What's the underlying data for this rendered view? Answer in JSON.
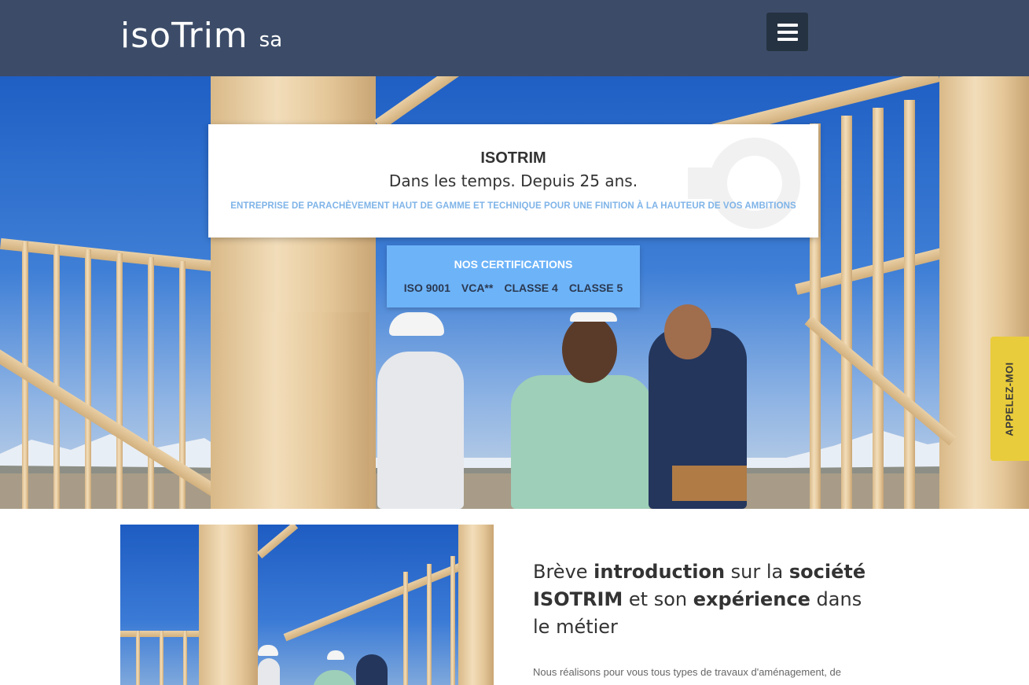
{
  "header": {
    "logo_main": "isoTrim",
    "logo_sub": "sa",
    "menu_icon": "hamburger-icon"
  },
  "hero": {
    "title": "ISOTRIM",
    "subtitle": "Dans les temps. Depuis 25 ans.",
    "description": "ENTREPRISE DE PARACHÈVEMENT HAUT DE GAMME ET TECHNIQUE POUR UNE FINITION À LA HAUTEUR DE VOS AMBITIONS",
    "certifications": {
      "title": "NOS CERTIFICATIONS",
      "items": [
        "ISO 9001",
        "VCA**",
        "CLASSE 4",
        "CLASSE 5"
      ]
    }
  },
  "call_tab": {
    "label": "APPELEZ-MOI"
  },
  "intro": {
    "title_parts": [
      {
        "text": "Brève ",
        "bold": false
      },
      {
        "text": "introduction",
        "bold": true
      },
      {
        "text": " sur la ",
        "bold": false
      },
      {
        "text": "société",
        "bold": true
      },
      {
        "text": " ",
        "bold": false
      },
      {
        "text": "ISOTRIM",
        "bold": true
      },
      {
        "text": " et son ",
        "bold": false
      },
      {
        "text": "expérience",
        "bold": true
      },
      {
        "text": " dans le métier",
        "bold": false
      }
    ],
    "text": "Nous réalisons pour vous tous types de travaux d'aménagement, de"
  },
  "colors": {
    "header_bg": "#3c4c68",
    "accent_blue": "#6db3f8",
    "call_yellow": "#e9cc3b"
  }
}
